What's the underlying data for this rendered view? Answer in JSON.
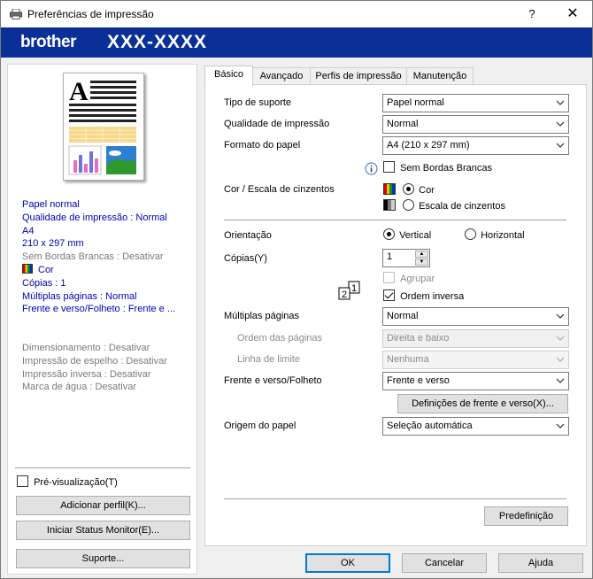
{
  "window": {
    "title": "Preferências de impressão",
    "help_glyph": "?",
    "close_glyph": "✕"
  },
  "banner": {
    "brand": "brother",
    "model": "XXX-XXXX"
  },
  "preview": {
    "summary_active": [
      "Papel normal",
      "Qualidade de impressão : Normal",
      "A4",
      "210 x 297 mm"
    ],
    "borderless": "Sem Bordas Brancas : Desativar",
    "color": "Cor",
    "summary_after": [
      "Cópias : 1",
      "Múltiplas páginas : Normal",
      "Frente e verso/Folheto : Frente e ..."
    ],
    "summary_inactive": [
      "Dimensionamento : Desativar",
      "Impressão de espelho : Desativar",
      "Impressão inversa : Desativar",
      "Marca de água : Desativar"
    ],
    "preview_checkbox": "Pré-visualização(T)",
    "add_profile": "Adicionar perfil(K)...",
    "status_monitor": "Iniciar Status Monitor(E)...",
    "support": "Suporte..."
  },
  "tabs": [
    {
      "label": "Básico",
      "active": true
    },
    {
      "label": "Avançado",
      "active": false
    },
    {
      "label": "Perfis de impressão",
      "active": false
    },
    {
      "label": "Manutenção",
      "active": false
    }
  ],
  "basic": {
    "media_type": {
      "label": "Tipo de suporte",
      "value": "Papel normal"
    },
    "quality": {
      "label": "Qualidade de impressão",
      "value": "Normal"
    },
    "paper_size": {
      "label": "Formato do papel",
      "value": "A4 (210 x 297 mm)"
    },
    "borderless": {
      "label": "Sem Bordas Brancas",
      "checked": false
    },
    "color_mode": {
      "label": "Cor / Escala de cinzentos",
      "color": "Cor",
      "gray": "Escala de cinzentos",
      "selected": "Cor"
    },
    "orientation": {
      "label": "Orientação",
      "portrait": "Vertical",
      "landscape": "Horizontal",
      "selected": "Vertical"
    },
    "copies": {
      "label": "Cópias(Y)",
      "value": "1"
    },
    "collate": {
      "label": "Agrupar",
      "checked": false,
      "disabled": true
    },
    "reverse": {
      "label": "Ordem inversa",
      "checked": true
    },
    "multi_page": {
      "label": "Múltiplas páginas",
      "value": "Normal"
    },
    "page_order": {
      "label": "Ordem das páginas",
      "value": "Direita e baixo"
    },
    "border_line": {
      "label": "Linha de limite",
      "value": "Nenhuma"
    },
    "duplex": {
      "label": "Frente e verso/Folheto",
      "value": "Frente e verso"
    },
    "duplex_settings": "Definições de frente e verso(X)...",
    "paper_source": {
      "label": "Origem do papel",
      "value": "Seleção automática"
    },
    "default_button": "Predefinição"
  },
  "footer": {
    "ok": "OK",
    "cancel": "Cancelar",
    "help": "Ajuda"
  }
}
